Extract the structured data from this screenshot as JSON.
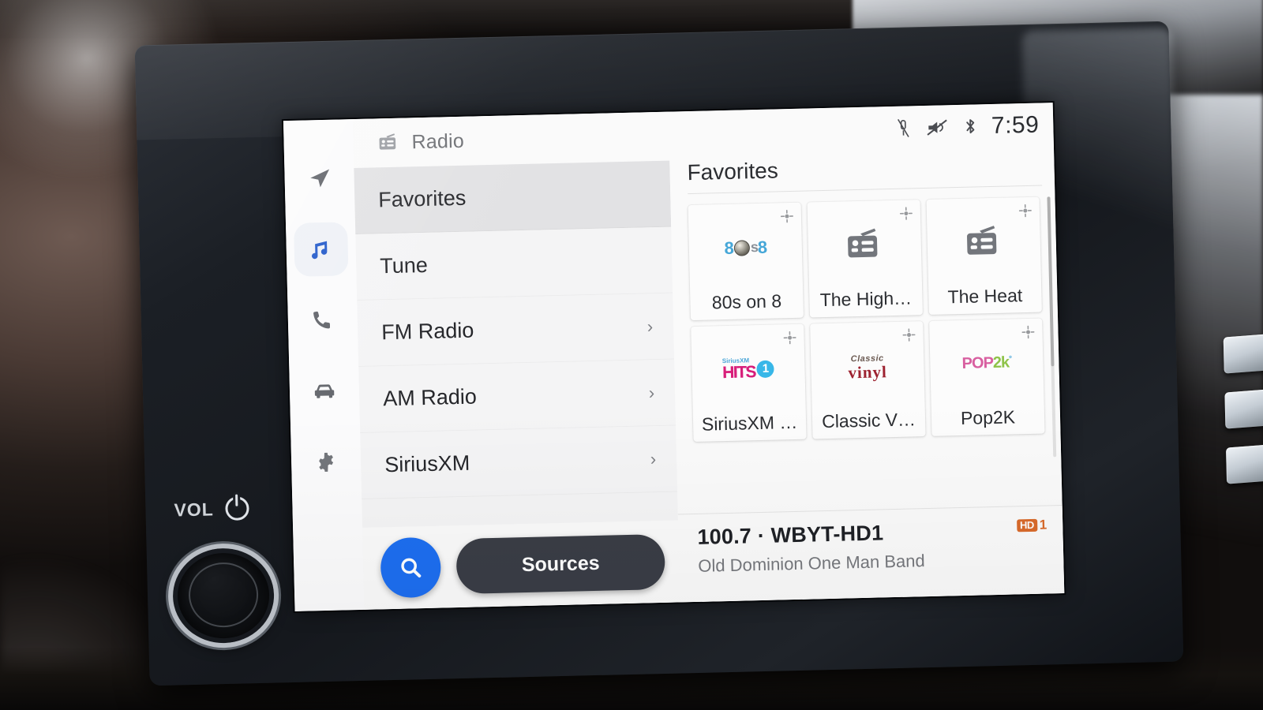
{
  "device": {
    "hardware_labels": {
      "volume": "VOL",
      "power_icon": "power-icon"
    },
    "right_buttons": [
      "hard-button-1",
      "hard-button-2",
      "hard-button-3"
    ]
  },
  "sidebar": {
    "items": [
      {
        "id": "navigation",
        "icon": "navigation-arrow-icon",
        "active": false
      },
      {
        "id": "media",
        "icon": "music-note-icon",
        "active": true
      },
      {
        "id": "phone",
        "icon": "phone-icon",
        "active": false
      },
      {
        "id": "vehicle",
        "icon": "car-icon",
        "active": false
      },
      {
        "id": "settings",
        "icon": "gear-icon",
        "active": false
      }
    ],
    "accent_color": "#1d6ef0"
  },
  "menu": {
    "header_icon": "radio-icon",
    "header_title": "Radio",
    "items": [
      {
        "label": "Favorites",
        "selected": true,
        "chevron": false
      },
      {
        "label": "Tune",
        "selected": false,
        "chevron": false
      },
      {
        "label": "FM Radio",
        "selected": false,
        "chevron": true,
        "chevron_glyph": "›"
      },
      {
        "label": "AM Radio",
        "selected": false,
        "chevron": true,
        "chevron_glyph": "›"
      },
      {
        "label": "SiriusXM",
        "selected": false,
        "chevron": true,
        "chevron_glyph": "›"
      }
    ],
    "search_icon": "search-icon",
    "sources_label": "Sources"
  },
  "statusbar": {
    "icons": [
      "microphone-mute-icon",
      "media-muted-icon",
      "bluetooth-icon"
    ],
    "time": "7:59"
  },
  "favorites": {
    "title": "Favorites",
    "pin_icon": "pin-icon",
    "tiles": [
      {
        "label": "80s on 8",
        "logo": "sirius-80s-on-8-logo",
        "logo_type": "text-80s"
      },
      {
        "label": "The High…",
        "logo": "radio-icon",
        "logo_type": "radio"
      },
      {
        "label": "The Heat",
        "logo": "radio-icon",
        "logo_type": "radio"
      },
      {
        "label": "SiriusXM …",
        "logo": "siriusxm-hits-1-logo",
        "logo_type": "hits1"
      },
      {
        "label": "Classic V…",
        "logo": "classic-vinyl-logo",
        "logo_type": "vinyl"
      },
      {
        "label": "Pop2K",
        "logo": "pop2k-logo",
        "logo_type": "pop2k"
      }
    ]
  },
  "now_playing": {
    "station": "100.7 · WBYT-HD1",
    "artist_track": "Old Dominion   One Man Band",
    "hd_label": "HD",
    "hd_channel": "1",
    "hd_color": "#d96a2b"
  },
  "logo_text": {
    "eighties": {
      "left": "8",
      "mid": "s",
      "right": "8"
    },
    "hits1": {
      "top": "SiriusXM",
      "main": "HITS",
      "num": "1"
    },
    "vinyl": {
      "top": "Classic",
      "main": "vinyl"
    },
    "pop2k": {
      "main": "POP",
      "k": "2k",
      "sup": "°"
    }
  }
}
